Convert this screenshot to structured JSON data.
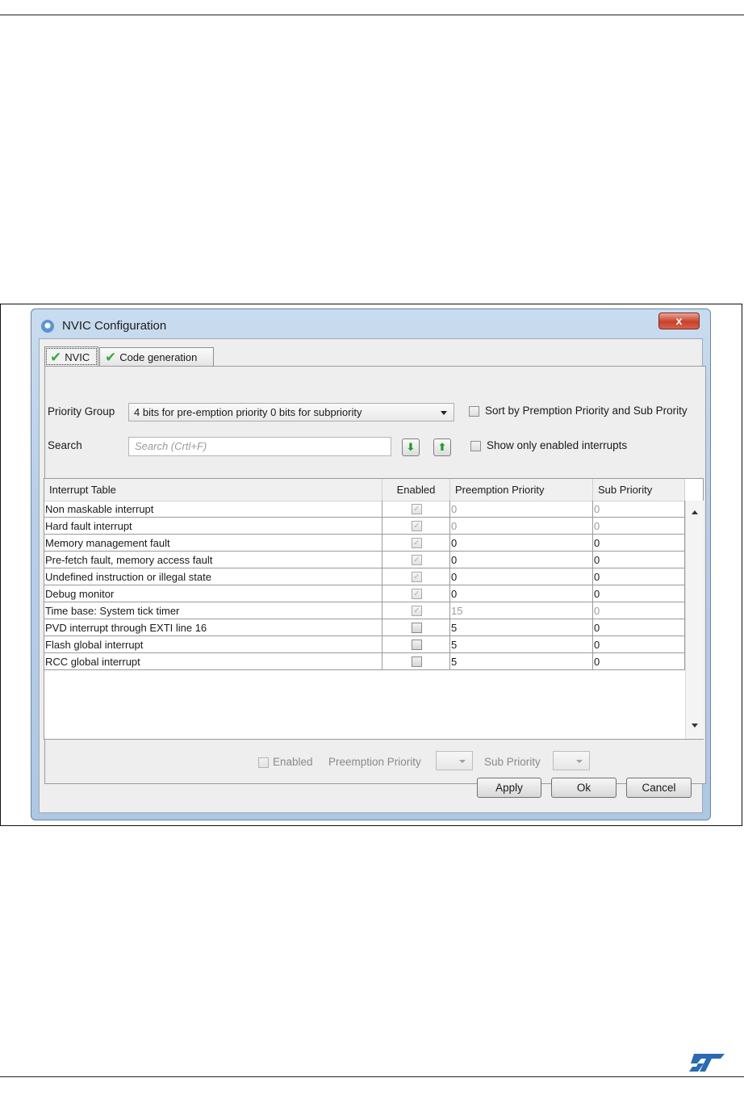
{
  "window": {
    "title": "NVIC Configuration",
    "close_label": "x"
  },
  "tabs": [
    {
      "label": "NVIC",
      "active": true
    },
    {
      "label": "Code generation",
      "active": false
    }
  ],
  "form": {
    "priority_group_label": "Priority Group",
    "priority_group_value": "4 bits for pre-emption priority 0 bits for subpriority",
    "sort_label": "Sort by Premption Priority and Sub Prority",
    "search_label": "Search",
    "search_placeholder": "Search (Crtl+F)",
    "show_only_enabled_label": "Show only enabled interrupts"
  },
  "table": {
    "columns": [
      "Interrupt Table",
      "Enabled",
      "Preemption Priority",
      "Sub Priority"
    ],
    "rows": [
      {
        "name": "Non maskable interrupt",
        "enabled": true,
        "locked": true,
        "preemption": "0",
        "sub": "0",
        "grey_values": true
      },
      {
        "name": "Hard fault interrupt",
        "enabled": true,
        "locked": true,
        "preemption": "0",
        "sub": "0",
        "grey_values": true
      },
      {
        "name": "Memory management fault",
        "enabled": true,
        "locked": true,
        "preemption": "0",
        "sub": "0",
        "grey_values": false
      },
      {
        "name": "Pre-fetch fault, memory access fault",
        "enabled": true,
        "locked": true,
        "preemption": "0",
        "sub": "0",
        "grey_values": false
      },
      {
        "name": "Undefined instruction or illegal state",
        "enabled": true,
        "locked": true,
        "preemption": "0",
        "sub": "0",
        "grey_values": false
      },
      {
        "name": "Debug monitor",
        "enabled": true,
        "locked": true,
        "preemption": "0",
        "sub": "0",
        "grey_values": false
      },
      {
        "name": "Time base: System tick timer",
        "enabled": true,
        "locked": true,
        "preemption": "15",
        "sub": "0",
        "grey_values": true
      },
      {
        "name": "PVD interrupt through EXTI line 16",
        "enabled": false,
        "locked": false,
        "preemption": "5",
        "sub": "0",
        "grey_values": false
      },
      {
        "name": "Flash global interrupt",
        "enabled": false,
        "locked": false,
        "preemption": "5",
        "sub": "0",
        "grey_values": false
      },
      {
        "name": "RCC global interrupt",
        "enabled": false,
        "locked": false,
        "preemption": "5",
        "sub": "0",
        "grey_values": false
      }
    ]
  },
  "bottom_bar": {
    "enabled_label": "Enabled",
    "preemption_label": "Preemption Priority",
    "sub_label": "Sub Priority"
  },
  "buttons": {
    "apply": "Apply",
    "ok": "Ok",
    "cancel": "Cancel"
  },
  "colors": {
    "check_green": "#39a93c",
    "close_red": "#c8402b",
    "title_bar_blue": "#b8cfe8"
  }
}
